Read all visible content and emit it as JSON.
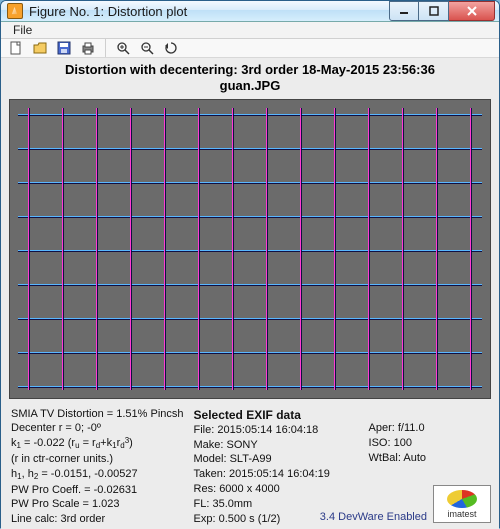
{
  "window": {
    "title": "Figure No. 1: Distortion plot"
  },
  "menu": {
    "file": "File"
  },
  "toolbar": {
    "new": "new",
    "open": "open",
    "save": "save",
    "print": "print",
    "zoom_in": "zoom-in",
    "zoom_out": "zoom-out",
    "rotate": "rotate"
  },
  "plot": {
    "title_line1": "Distortion with decentering:  3rd order      18-May-2015 23:56:36",
    "title_line2": "guan.JPG"
  },
  "left_panel": {
    "l1": "SMIA TV Distortion = 1.51% Pincsh",
    "l2": "Decenter r = 0;  -0º",
    "l3_a": "k",
    "l3_b": " = -0.022   (r",
    "l3_c": " = r",
    "l3_d": "+k",
    "l3_e": "r",
    "l3_f": ")",
    "l4": "(r in ctr-corner units.)",
    "l5_a": "h",
    "l5_b": ", h",
    "l5_c": " = -0.0151, -0.00527",
    "l6": "PW Pro Coeff. = -0.02631",
    "l7": "PW Pro Scale = 1.023",
    "l8": "Line calc: 3rd order"
  },
  "mid_panel": {
    "hdr": "Selected EXIF data",
    "m1": "File:  2015:05:14 16:04:18",
    "m2": "Make:  SONY",
    "m3": "Model: SLT-A99",
    "m4": "Taken: 2015:05:14 16:04:19",
    "m5": "Res:  6000 x 4000",
    "m6": "FL:  35.0mm",
    "m7": "Exp:  0.500 s  (1/2)"
  },
  "right_panel": {
    "r1": "Aper:  f/11.0",
    "r2": "ISO:  100",
    "r3": "WtBal: Auto"
  },
  "footer": {
    "ver": "3.4  DevWare Enabled"
  },
  "logo": {
    "name": "imatest"
  },
  "chart_data": {
    "type": "grid",
    "title": "Distortion with decentering: 3rd order",
    "date": "18-May-2015 23:56:36",
    "source_file": "guan.JPG",
    "h_lines": 9,
    "v_lines": 14,
    "distortion_pct": 1.51,
    "distortion_sign": "Pincushion",
    "k1": -0.022,
    "decenter_r": 0,
    "decenter_deg": 0,
    "h1": -0.0151,
    "h2": -0.00527,
    "pw_pro_coeff": -0.02631,
    "pw_pro_scale": 1.023,
    "order": "3rd"
  }
}
